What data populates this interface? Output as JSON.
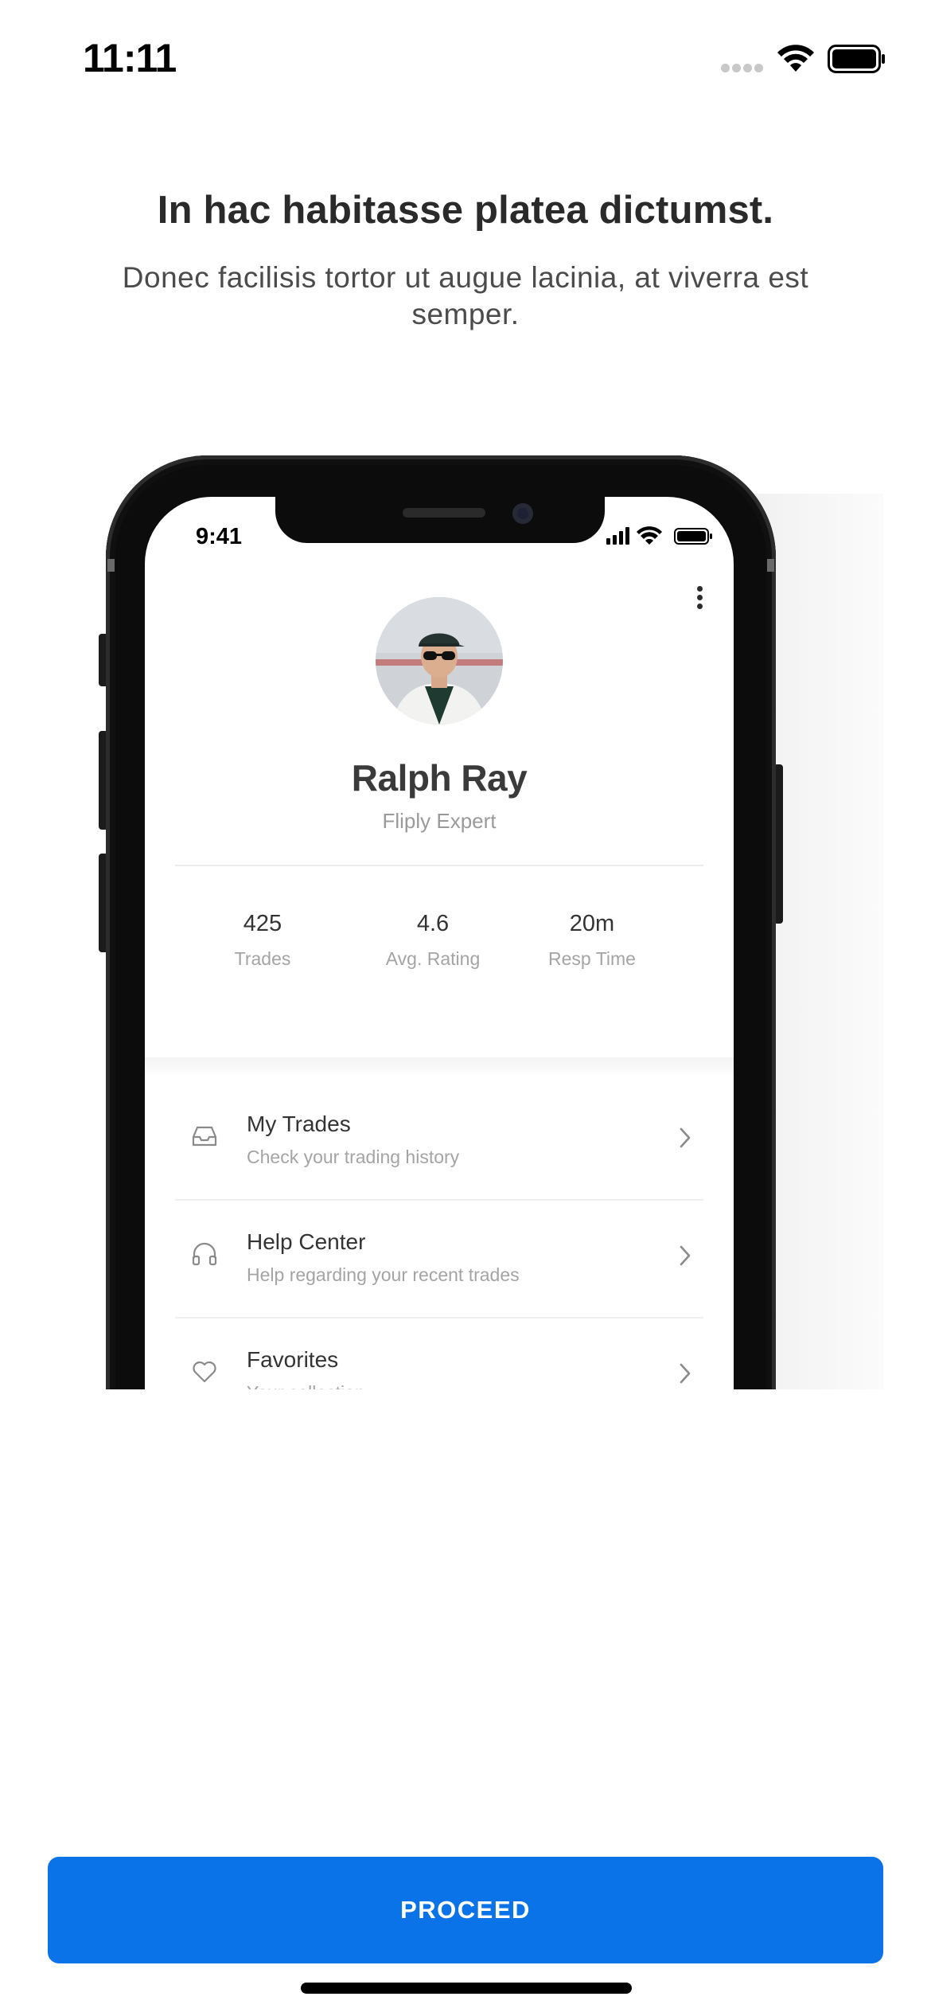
{
  "status_bar": {
    "time": "11:11"
  },
  "hero": {
    "title": "In hac habitasse platea dictumst.",
    "subtitle": "Donec facilisis tortor ut augue lacinia, at viverra est semper."
  },
  "mock_phone": {
    "time": "9:41",
    "profile": {
      "name": "Ralph Ray",
      "role": "Fliply Expert"
    },
    "stats": [
      {
        "value": "425",
        "label": "Trades"
      },
      {
        "value": "4.6",
        "label": "Avg. Rating"
      },
      {
        "value": "20m",
        "label": "Resp Time"
      }
    ],
    "menu": [
      {
        "title": "My Trades",
        "subtitle": "Check your trading history",
        "icon": "inbox-icon"
      },
      {
        "title": "Help Center",
        "subtitle": "Help regarding your recent trades",
        "icon": "headphones-icon"
      },
      {
        "title": "Favorites",
        "subtitle": "Your collection",
        "icon": "heart-icon"
      }
    ]
  },
  "actions": {
    "proceed_label": "PROCEED"
  },
  "colors": {
    "primary": "#0A73E8",
    "text_dark": "#2A2A2A",
    "text_muted": "#A4A4A4"
  }
}
